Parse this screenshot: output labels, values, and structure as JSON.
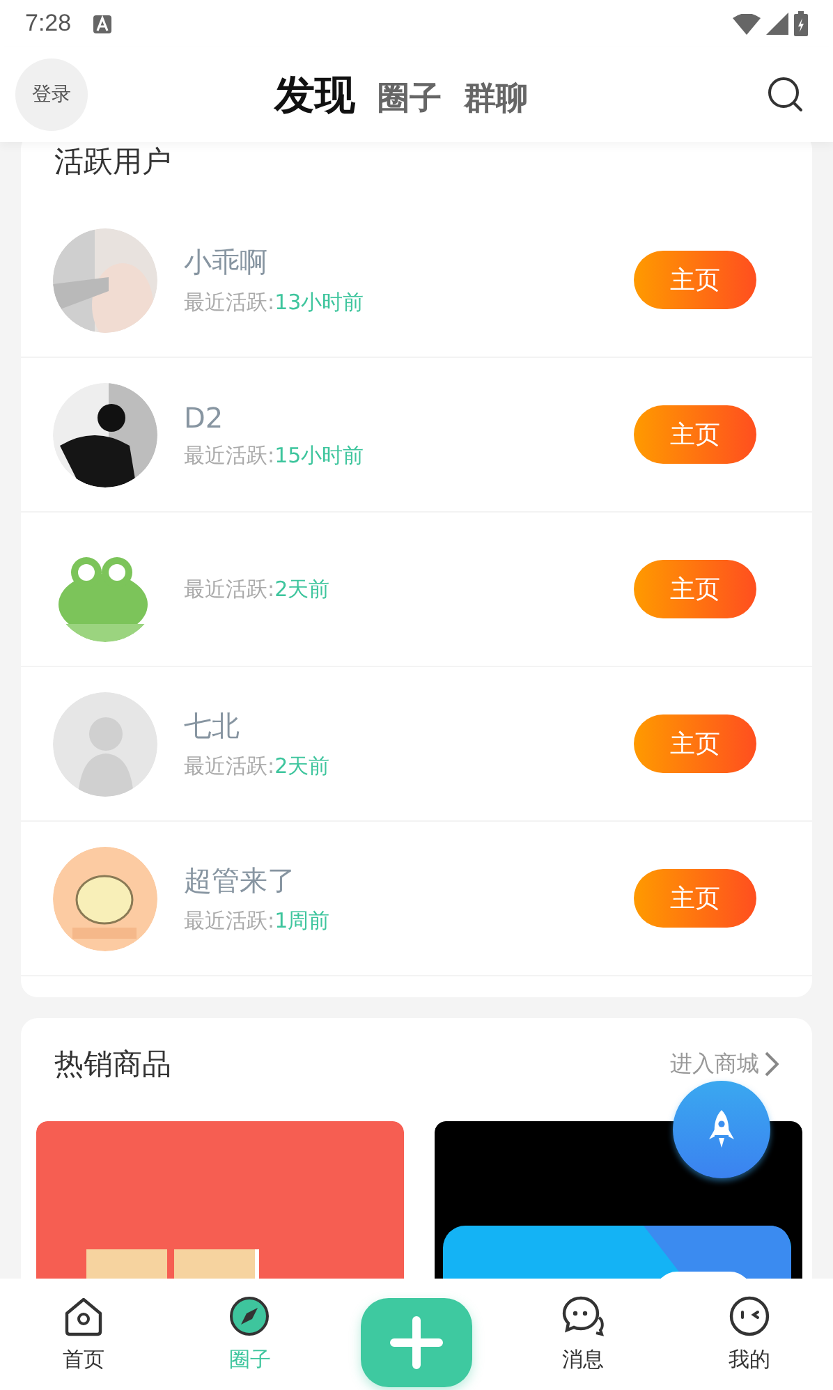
{
  "status_bar": {
    "time": "7:28"
  },
  "header": {
    "login": "登录",
    "tabs": [
      {
        "label": "发现",
        "selected": true
      },
      {
        "label": "圈子",
        "selected": false
      },
      {
        "label": "群聊",
        "selected": false
      }
    ]
  },
  "active_users": {
    "title": "活跃用户",
    "users": [
      {
        "name": "小乖啊",
        "activity_label": "最近活跃:",
        "activity_time": "13小时前",
        "button": "主页"
      },
      {
        "name": "D2",
        "activity_label": "最近活跃:",
        "activity_time": "15小时前",
        "button": "主页"
      },
      {
        "activity_label": "最近活跃:",
        "activity_time": "2天前",
        "button": "主页"
      },
      {
        "name": "七北",
        "activity_label": "最近活跃:",
        "activity_time": "2天前",
        "button": "主页"
      },
      {
        "name": "超管来了",
        "activity_label": "最近活跃:",
        "activity_time": "1周前",
        "button": "主页"
      }
    ]
  },
  "hot_products": {
    "title": "热销商品",
    "more_link": "进入商城"
  },
  "bottom_nav": {
    "items": [
      {
        "kind": "home",
        "label": "首页",
        "selected": false
      },
      {
        "kind": "compass",
        "label": "圈子",
        "selected": true
      },
      {
        "kind": "add"
      },
      {
        "kind": "chat",
        "label": "消息",
        "selected": false
      },
      {
        "kind": "face",
        "label": "我的",
        "selected": false
      }
    ]
  }
}
